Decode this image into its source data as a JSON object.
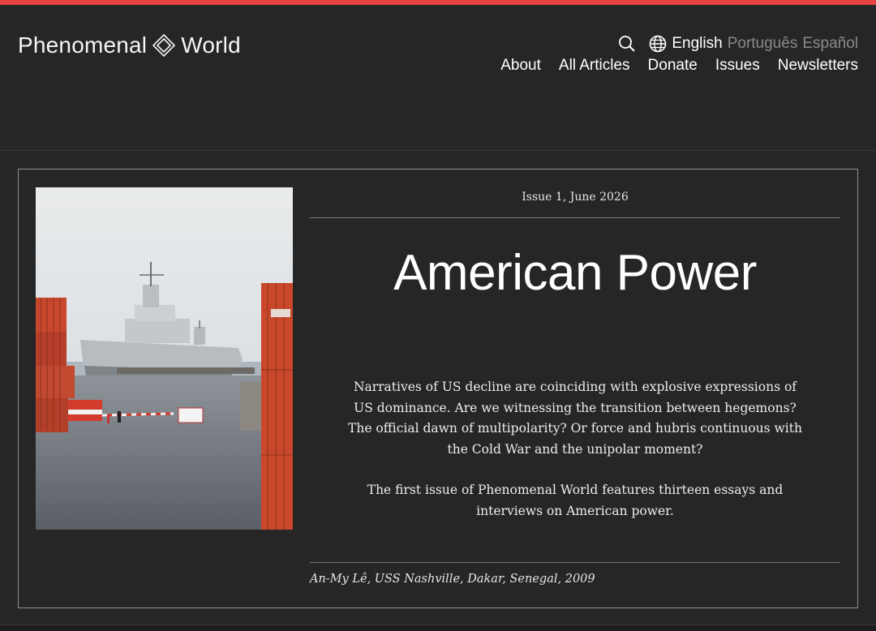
{
  "colors": {
    "accent": "#e8423f",
    "background": "#262626",
    "text": "#ffffff",
    "muted": "#8a8a8a"
  },
  "header": {
    "logo_left": "Phenomenal",
    "logo_right": "World",
    "logo_icon": "diamond-logo-icon",
    "search_icon": "search-icon",
    "globe_icon": "globe-icon",
    "languages": {
      "active": "English",
      "others": [
        "Português",
        "Español"
      ]
    },
    "nav": [
      "About",
      "All Articles",
      "Donate",
      "Issues",
      "Newsletters"
    ]
  },
  "feature": {
    "issue_meta": "Issue 1, June 2026",
    "title": "American Power",
    "paragraphs": [
      "Narratives of US decline are coinciding with explosive expressions of US dominance. Are we witnessing the transition between hegemons? The official dawn of multipolarity? Or force and hubris continuous with the Cold War and the unipolar moment?",
      "The first issue of Phenomenal World features thirteen essays and interviews on American power."
    ],
    "image_caption": "An-My Lê, USS Nashville, Dakar, Senegal, 2009"
  }
}
